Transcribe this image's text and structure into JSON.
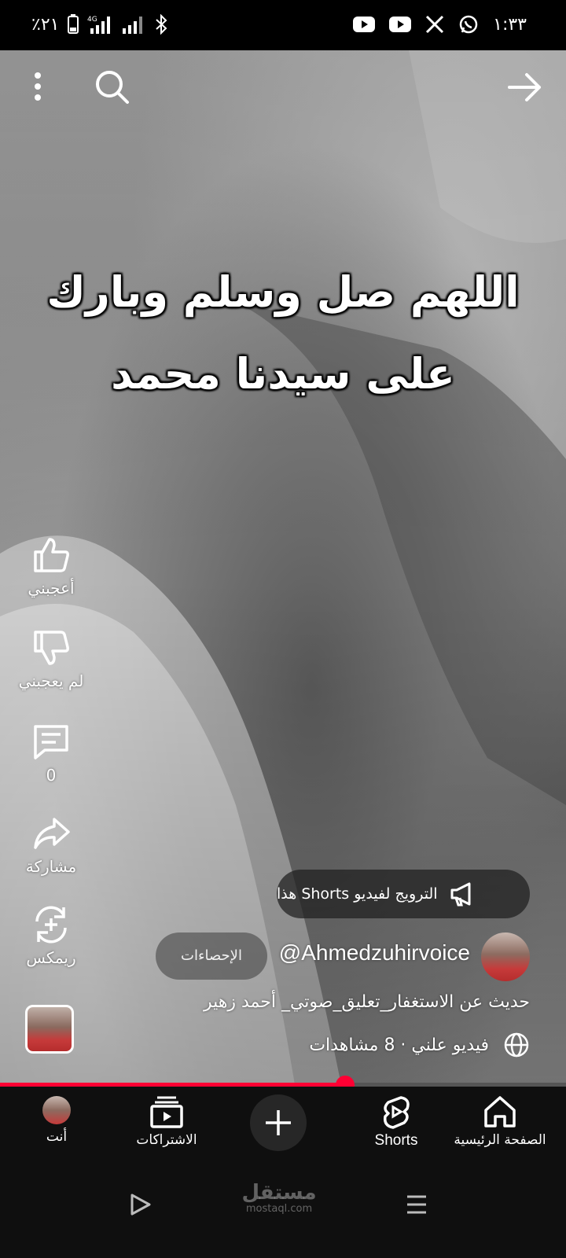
{
  "status_bar": {
    "battery": "٪٢١",
    "network": "4G",
    "time": "١:٣٣"
  },
  "video": {
    "overlay_line1": "اللهم صل وسلم وبارك",
    "overlay_line2": "على سيدنا محمد"
  },
  "actions": {
    "like_label": "أعجبني",
    "dislike_label": "لم يعجبني",
    "comments_count": "0",
    "share_label": "مشاركة",
    "remix_label": "ريمكس"
  },
  "promote": {
    "label": "الترويج لفيديو Shorts هذا"
  },
  "channel": {
    "handle": "@Ahmedzuhirvoice",
    "stats_label": "الإحصاءات"
  },
  "video_info": {
    "title": "حديث عن الاستغفار_تعليق_صوتي_ أحمد زهير",
    "meta": "فيديو علني · 8 مشاهدات"
  },
  "playback": {
    "progress": 0.61
  },
  "bottom_nav": {
    "home": "الصفحة الرئيسية",
    "shorts": "Shorts",
    "subscriptions": "الاشتراكات",
    "you": "أنت"
  },
  "watermark": {
    "main": "مستقل",
    "sub": "mostaql.com"
  },
  "colors": {
    "accent": "#ff0033",
    "nav_bg": "#0f0f0f"
  }
}
